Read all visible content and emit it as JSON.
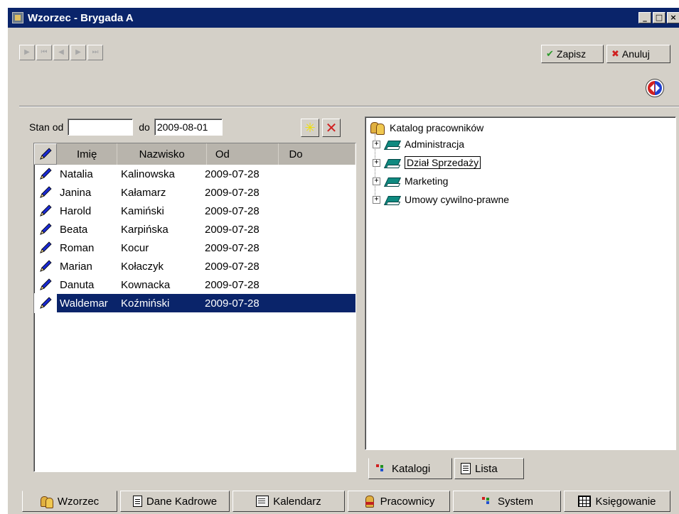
{
  "window": {
    "title": "Wzorzec - Brygada A",
    "min_glyph": "_",
    "max_glyph": "□",
    "close_glyph": "×"
  },
  "nav": {
    "first_glyph": "▶",
    "prev_first_glyph": "⏮",
    "prev_glyph": "◀",
    "next_glyph": "▶",
    "last_glyph": "⏭"
  },
  "toolbar": {
    "save_label": "Zapisz",
    "save_icon": "✔",
    "cancel_label": "Anuluj",
    "cancel_icon": "✖"
  },
  "filter": {
    "from_label": "Stan od",
    "from_value": "",
    "to_label": "do",
    "to_value": "2009-08-01",
    "add_glyph": "✳",
    "delete_glyph": "✕"
  },
  "grid": {
    "columns": [
      "Imię",
      "Nazwisko",
      "Od",
      "Do"
    ],
    "rows": [
      {
        "imie": "Natalia",
        "nazwisko": "Kalinowska",
        "od": "2009-07-28",
        "do": ""
      },
      {
        "imie": "Janina",
        "nazwisko": "Kałamarz",
        "od": "2009-07-28",
        "do": ""
      },
      {
        "imie": "Harold",
        "nazwisko": "Kamiński",
        "od": "2009-07-28",
        "do": ""
      },
      {
        "imie": "Beata",
        "nazwisko": "Karpińska",
        "od": "2009-07-28",
        "do": ""
      },
      {
        "imie": "Roman",
        "nazwisko": "Kocur",
        "od": "2009-07-28",
        "do": ""
      },
      {
        "imie": "Marian",
        "nazwisko": "Kołaczyk",
        "od": "2009-07-28",
        "do": ""
      },
      {
        "imie": "Danuta",
        "nazwisko": "Kownacka",
        "od": "2009-07-28",
        "do": ""
      },
      {
        "imie": "Waldemar",
        "nazwisko": "Koźmiński",
        "od": "2009-07-28",
        "do": ""
      }
    ],
    "selected_row_index": 7
  },
  "tree": {
    "root_label": "Katalog pracowników",
    "items": [
      {
        "label": "Administracja"
      },
      {
        "label": "Dział Sprzedaży"
      },
      {
        "label": "Marketing"
      },
      {
        "label": "Umowy cywilno-prawne"
      }
    ]
  },
  "right_tabs": {
    "katalogi": "Katalogi",
    "lista": "Lista"
  },
  "bottom_tabs": {
    "wzorzec": "Wzorzec",
    "dane_kadrowe": "Dane Kadrowe",
    "kalendarz": "Kalendarz",
    "pracownicy": "Pracownicy",
    "system": "System",
    "ksiegowanie": "Księgowanie"
  },
  "colors": {
    "titlebar": "#0a246a",
    "face": "#d4d0c8",
    "selection": "#0a246a",
    "save_check": "#2a9a2a",
    "cancel_x": "#d02020",
    "pen": "#1a2ad0"
  }
}
